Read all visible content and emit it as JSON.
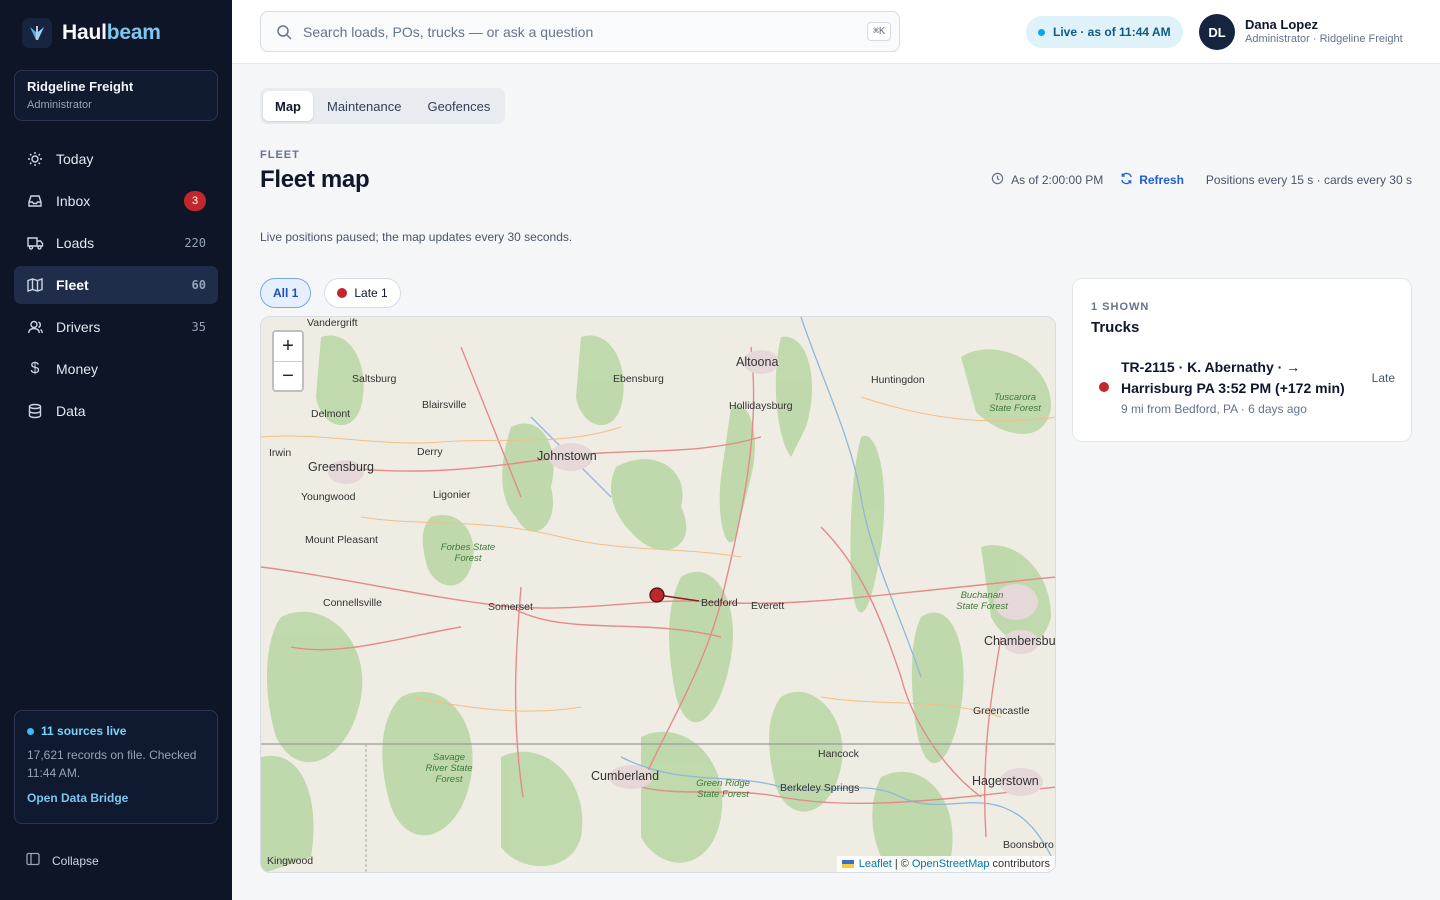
{
  "brand": {
    "name_part1": "Haul",
    "name_part2": "beam"
  },
  "org": {
    "name": "Ridgeline Freight",
    "role": "Administrator"
  },
  "nav": [
    {
      "label": "Today",
      "icon": "sun-icon"
    },
    {
      "label": "Inbox",
      "icon": "inbox-icon",
      "badge": "3"
    },
    {
      "label": "Loads",
      "icon": "truck-icon",
      "count": "220"
    },
    {
      "label": "Fleet",
      "icon": "map-icon",
      "count": "60",
      "active": true
    },
    {
      "label": "Drivers",
      "icon": "users-icon",
      "count": "35"
    },
    {
      "label": "Money",
      "icon": "dollar-icon"
    },
    {
      "label": "Data",
      "icon": "database-icon"
    }
  ],
  "sources": {
    "title": "11 sources live",
    "text": "17,621 records on file. Checked 11:44 AM.",
    "link": "Open Data Bridge"
  },
  "collapse_label": "Collapse",
  "search": {
    "placeholder": "Search loads, POs, trucks — or ask a question",
    "shortcut": "⌘K"
  },
  "live_status": "Live · as of 11:44 AM",
  "user": {
    "initials": "DL",
    "name": "Dana Lopez",
    "role": "Administrator · Ridgeline Freight"
  },
  "tabs": [
    "Map",
    "Maintenance",
    "Geofences"
  ],
  "page": {
    "eyebrow": "FLEET",
    "title": "Fleet map",
    "as_of": "As of 2:00:00 PM",
    "refresh": "Refresh",
    "cadence": "Positions every 15 s · cards every 30 s",
    "notice": "Live positions paused; the map updates every 30 seconds."
  },
  "filters": [
    {
      "label": "All 1",
      "active": true
    },
    {
      "label": "Late 1",
      "active": false,
      "dot_color": "#c0272d"
    }
  ],
  "map": {
    "zoom_in": "+",
    "zoom_out": "−",
    "attribution_leaflet": "Leaflet",
    "attribution_sep": "| ©",
    "attribution_osm": "OpenStreetMap",
    "attribution_tail": "contributors",
    "places": [
      {
        "name": "Vandergrift",
        "size": "s"
      },
      {
        "name": "Altoona",
        "size": "m"
      },
      {
        "name": "Saltsburg",
        "size": "s"
      },
      {
        "name": "Ebensburg",
        "size": "s"
      },
      {
        "name": "Huntingdon",
        "size": "s"
      },
      {
        "name": "Blairsville",
        "size": "s"
      },
      {
        "name": "Hollidaysburg",
        "size": "s"
      },
      {
        "name": "Delmont",
        "size": "s"
      },
      {
        "name": "Johnstown",
        "size": "m"
      },
      {
        "name": "Irwin",
        "size": "s"
      },
      {
        "name": "Derry",
        "size": "s"
      },
      {
        "name": "Greensburg",
        "size": "m"
      },
      {
        "name": "Youngwood",
        "size": "s"
      },
      {
        "name": "Ligonier",
        "size": "s"
      },
      {
        "name": "Mount Pleasant",
        "size": "s"
      },
      {
        "name": "Connellsville",
        "size": "s"
      },
      {
        "name": "Somerset",
        "size": "s"
      },
      {
        "name": "Bedford",
        "size": "s"
      },
      {
        "name": "Everett",
        "size": "s"
      },
      {
        "name": "Chambersburg",
        "size": "m"
      },
      {
        "name": "Greencastle",
        "size": "s"
      },
      {
        "name": "Hancock",
        "size": "s"
      },
      {
        "name": "Cumberland",
        "size": "m"
      },
      {
        "name": "Berkeley Springs",
        "size": "s"
      },
      {
        "name": "Hagerstown",
        "size": "m"
      },
      {
        "name": "Kingwood",
        "size": "s"
      },
      {
        "name": "Boonsboro",
        "size": "s"
      }
    ],
    "forests": [
      "Tuscarora State Forest",
      "Forbes State Forest",
      "Buchanan State Forest",
      "Savage River State Forest",
      "Green Ridge State Forest"
    ]
  },
  "panel": {
    "eyebrow": "1 SHOWN",
    "title": "Trucks",
    "truck": {
      "title": "TR-2115 · K. Abernathy · → Harrisburg PA 3:52 PM (+172 min)",
      "sub": "9 mi from Bedford, PA · 6 days ago",
      "status": "Late",
      "status_color": "#c0272d"
    }
  }
}
